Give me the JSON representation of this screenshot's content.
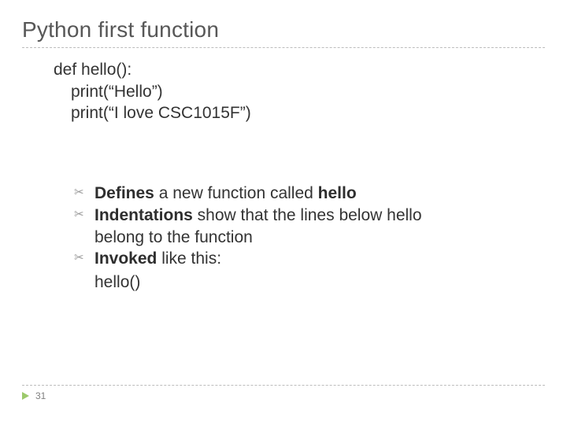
{
  "title": "Python first function",
  "code": {
    "line1": "def hello():",
    "line2": "print(“Hello”)",
    "line3": "print(“I love CSC1015F”)"
  },
  "bullets": {
    "b1_pre": "Defines",
    "b1_mid": " a new function called ",
    "b1_post": "hello",
    "b2_pre": "Indentations",
    "b2_rest": " show that  the lines below hello",
    "b2_cont": "belong to the function",
    "b3_pre": "Invoked",
    "b3_rest": " like this:"
  },
  "invoke_call": "hello()",
  "page_number": "31"
}
